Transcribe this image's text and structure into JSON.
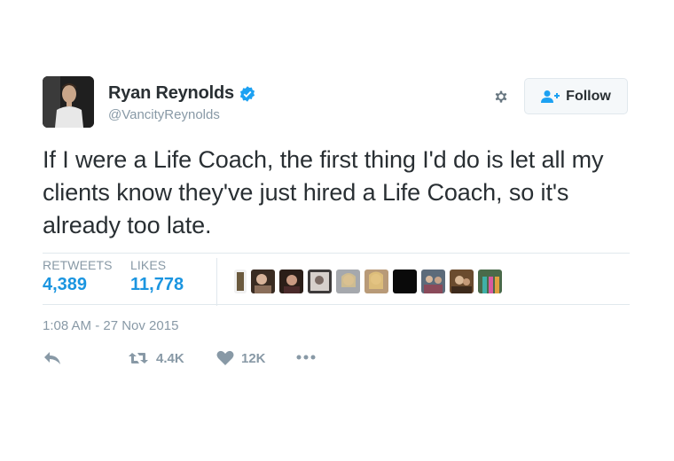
{
  "user": {
    "display_name": "Ryan Reynolds",
    "handle": "@VancityReynolds",
    "verified": true
  },
  "follow_button": {
    "label": "Follow"
  },
  "tweet": {
    "text": "If I were a Life Coach, the first thing I'd do is let all my clients know they've just hired a Life Coach, so it's already too late."
  },
  "stats": {
    "retweets_label": "RETWEETS",
    "retweets_count": "4,389",
    "likes_label": "LIKES",
    "likes_count": "11,778"
  },
  "timestamp": "1:08 AM - 27 Nov 2015",
  "actions": {
    "retweet_count": "4.4K",
    "like_count": "12K"
  },
  "colors": {
    "link_blue": "#1b95e0",
    "verified_blue": "#1da1f2",
    "secondary_gray": "#8899a6",
    "text": "#292f33"
  }
}
